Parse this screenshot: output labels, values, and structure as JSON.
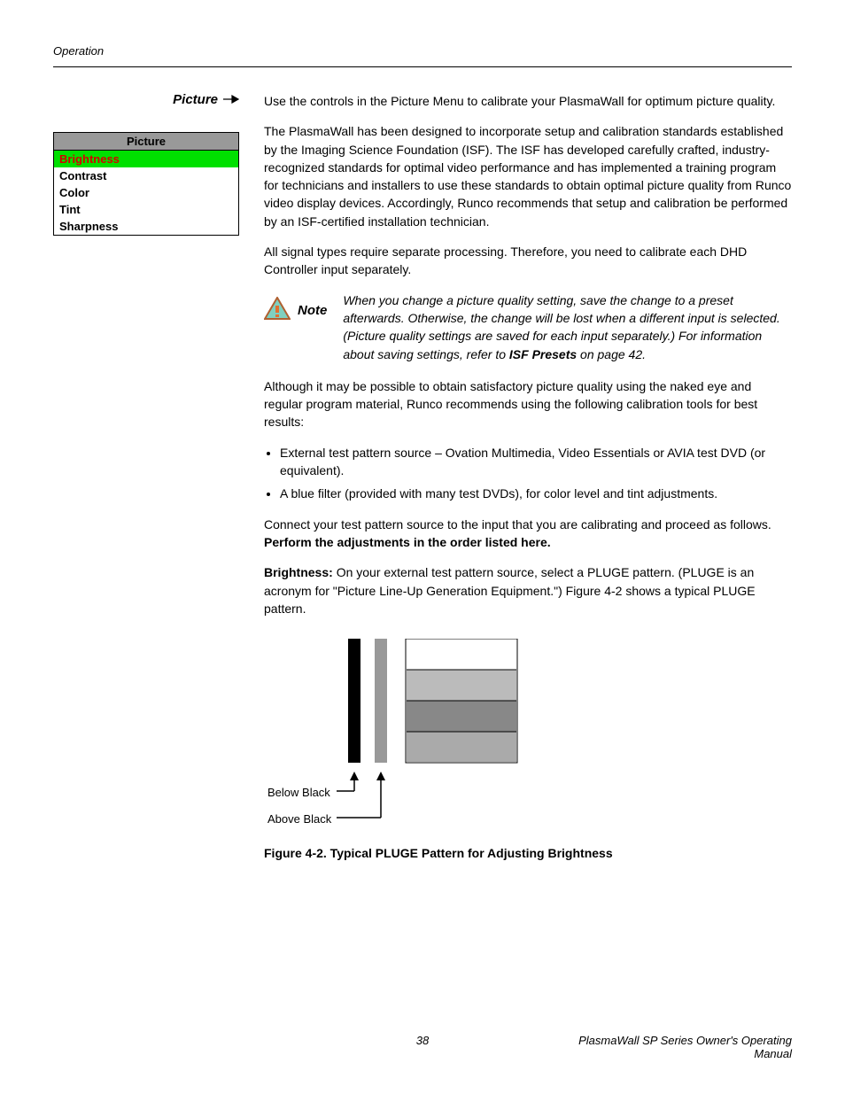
{
  "header": "Operation",
  "section_title": "Picture",
  "menu": {
    "title": "Picture",
    "items": [
      "Brightness",
      "Contrast",
      "Color",
      "Tint",
      "Sharpness"
    ],
    "active_index": 0
  },
  "p1": "Use the controls in the Picture Menu to calibrate your PlasmaWall for optimum picture quality.",
  "p2": "The PlasmaWall has been designed to incorporate setup and calibration standards established by the Imaging Science Foundation (ISF). The ISF has developed carefully crafted, industry-recognized standards for optimal video performance and has implemented a training program for technicians and installers to use these standards to obtain optimal picture quality from Runco video display devices. Accordingly, Runco recommends that setup and calibration be performed by an ISF-certified installation technician.",
  "p3": "All signal types require separate processing. Therefore, you need to calibrate each DHD Controller input separately.",
  "note_label": "Note",
  "note_text_1": "When you change a picture quality setting, save the change to a preset afterwards. Otherwise, the change will be lost when a different input is selected. (Picture quality settings are saved for each input separately.) For information about saving settings, refer to ",
  "note_bold": "ISF Presets",
  "note_text_2": " on page 42.",
  "p4": "Although it may be possible to obtain satisfactory picture quality using the naked eye and regular program material, Runco recommends using the following calibration tools for best results:",
  "bullet1": "External test pattern source – Ovation Multimedia, Video Essentials or AVIA test DVD (or equivalent).",
  "bullet2": "A blue filter (provided with many test DVDs), for color level and tint adjustments.",
  "p5_a": "Connect your test pattern source to the input that you are calibrating and proceed as follows. ",
  "p5_b": "Perform the adjustments in the order listed here.",
  "p6_a": "Brightness: ",
  "p6_b": "On your external test pattern source, select a PLUGE pattern. (PLUGE is an acronym for \"Picture Line-Up Generation Equipment.\") Figure 4-2 shows a typical PLUGE pattern.",
  "below_black": "Below Black",
  "above_black": "Above Black",
  "figure_caption": "Figure 4-2. Typical PLUGE Pattern for Adjusting Brightness",
  "page_number": "38",
  "manual_title": "PlasmaWall SP Series Owner's Operating Manual"
}
